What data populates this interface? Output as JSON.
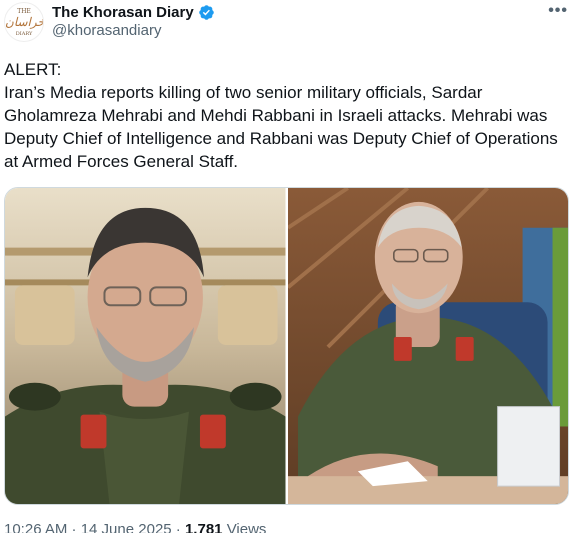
{
  "account": {
    "display_name": "The Khorasan Diary",
    "handle": "@khorasandiary",
    "verified_icon": "verified-badge-icon",
    "avatar_text_top": "THE",
    "avatar_text_bottom": "DIARY"
  },
  "menu": {
    "more_label": "•••"
  },
  "tweet": {
    "lines": [
      "ALERT:",
      "Iran’s Media reports killing of two senior military officials, Sardar Gholamreza Mehrabi and Mehdi Rabbani in Israeli attacks. Mehrabi was Deputy Chief of Intelligence and Rabbani was Deputy Chief of Operations at Armed Forces General Staff."
    ]
  },
  "media": {
    "photos": [
      "left-portrait-photo",
      "right-portrait-photo"
    ]
  },
  "footer": {
    "timestamp": "10:26 AM · 14 June 2025",
    "views_count": "1,781",
    "views_label": "Views"
  },
  "colors": {
    "text": "#0f1419",
    "secondary": "#536471",
    "verified": "#1d9bf0",
    "border": "#cfd9de"
  }
}
